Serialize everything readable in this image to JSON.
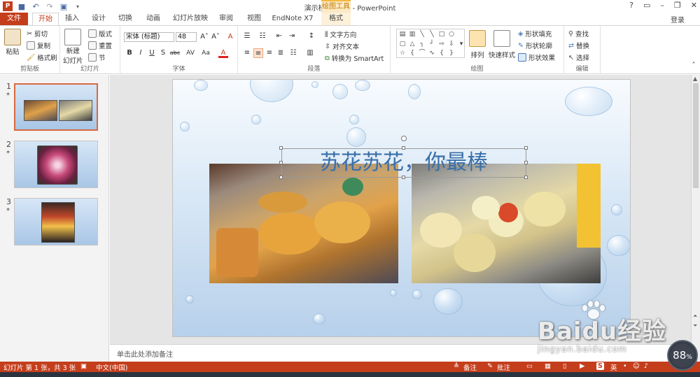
{
  "window": {
    "title": "演示模板.pptx - PowerPoint",
    "context_group": "绘图工具",
    "controls": [
      "?",
      "▭",
      "–",
      "❐",
      "✕"
    ],
    "login": "登录"
  },
  "tabs": [
    "文件",
    "开始",
    "插入",
    "设计",
    "切换",
    "动画",
    "幻灯片放映",
    "审阅",
    "视图",
    "EndNote X7",
    "格式"
  ],
  "ribbon": {
    "clipboard": {
      "paste": "粘贴",
      "cut": "剪切",
      "copy": "复制",
      "format_painter": "格式刷",
      "label": "剪贴板"
    },
    "slides": {
      "new_slide_line1": "新建",
      "new_slide_line2": "幻灯片",
      "layout": "版式",
      "reset": "重置",
      "section": "节",
      "label": "幻灯片"
    },
    "font": {
      "name": "宋体 (标题)",
      "size": "48",
      "bold": "B",
      "italic": "I",
      "underline": "U",
      "shadow": "S",
      "strike": "abc",
      "spacing": "AV",
      "case": "Aa",
      "color": "A",
      "grow": "A˄",
      "shrink": "A˅",
      "clear": "A",
      "label": "字体"
    },
    "paragraph": {
      "text_direction": "文字方向",
      "align_text": "对齐文本",
      "smartart": "转换为 SmartArt",
      "label": "段落"
    },
    "drawing": {
      "arrange": "排列",
      "quick_styles": "快速样式",
      "fill": "形状填充",
      "outline": "形状轮廓",
      "effects": "形状效果",
      "label": "绘图"
    },
    "editing": {
      "find": "查找",
      "replace": "替换",
      "select": "选择",
      "label": "编辑"
    }
  },
  "slides_panel": [
    {
      "number": "1",
      "star": "*"
    },
    {
      "number": "2",
      "star": "*"
    },
    {
      "number": "3",
      "star": "*"
    }
  ],
  "slide": {
    "title": "苏花苏花，你最棒"
  },
  "notes": {
    "placeholder": "单击此处添加备注"
  },
  "status": {
    "slide_info": "幻灯片 第 1 张，共 3 张",
    "language": "中文(中国)",
    "notes": "备注",
    "comments": "批注",
    "ime": "英"
  },
  "watermark": {
    "brand": "Baidu经验",
    "url": "jingyan.baidu.com"
  },
  "zoom": {
    "value": "88",
    "unit": "%"
  },
  "colors": {
    "accent": "#c43e1c",
    "title_text": "#3a6fa8",
    "context_tab": "#f5b83d"
  }
}
